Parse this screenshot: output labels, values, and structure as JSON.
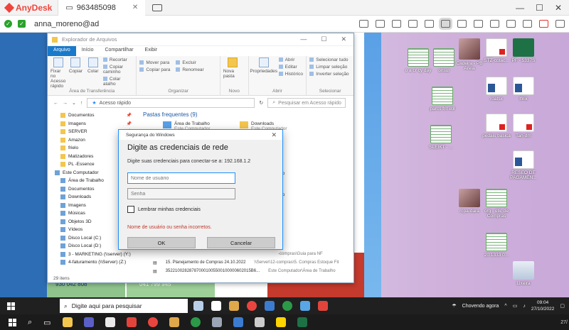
{
  "anydesk": {
    "app_name": "AnyDesk",
    "tab_label": "963485098",
    "address": "anna_moreno@ad"
  },
  "desktop_icons": [
    {
      "label": "o a cr cy day",
      "kind": "sheet"
    },
    {
      "label": "onsul",
      "kind": "sheet"
    },
    {
      "label": "Cadeira - PB Areia",
      "kind": "photo"
    },
    {
      "label": "STZ-cotac...",
      "kind": "pdf"
    },
    {
      "label": "PF - 5337S",
      "kind": "excel"
    },
    {
      "label": "parcs frit etil",
      "kind": "sheet"
    },
    {
      "label": "roatsx",
      "kind": "word"
    },
    {
      "label": "lflrik",
      "kind": "word"
    },
    {
      "label": "SLEIKT - ...",
      "kind": "sheet"
    },
    {
      "label": "pedais basica",
      "kind": "pdf"
    },
    {
      "label": "Tan-dm",
      "kind": "pdf"
    },
    {
      "label": "RESEO DE PAGAMEN...",
      "kind": "word"
    },
    {
      "label": "rcpa-dara",
      "kind": "photo"
    },
    {
      "label": "org - etic de Compras",
      "kind": "sheet"
    },
    {
      "label": "20:1333 0...",
      "kind": "sheet"
    },
    {
      "label": "Lixeira",
      "kind": "recycle"
    }
  ],
  "background": {
    "num1": "930 042 808",
    "num2": "041 799 945"
  },
  "explorer": {
    "title": "Explorador de Arquivos",
    "tabs": [
      "Arquivo",
      "Início",
      "Compartilhar",
      "Exibir"
    ],
    "ribbon": {
      "transfer": {
        "pin": "Fixar no Acesso rápido",
        "copy": "Copiar",
        "paste": "Colar",
        "cut": "Recortar",
        "copy_path": "Copiar caminho",
        "paste_shortcut": "Colar atalho",
        "group": "Área de Transferência"
      },
      "organize": {
        "move": "Mover para",
        "copy_to": "Copiar para",
        "delete": "Excluir",
        "rename": "Renomear",
        "group": "Organizar"
      },
      "new": {
        "new_folder": "Nova pasta",
        "group": "Novo"
      },
      "open": {
        "properties": "Propriedades",
        "open": "Abrir",
        "edit": "Editar",
        "history": "Histórico",
        "group": "Abrir"
      },
      "select": {
        "select_all": "Selecionar tudo",
        "clear": "Limpar seleção",
        "invert": "Inverter seleção",
        "group": "Selecionar"
      }
    },
    "path": "Acesso rápido",
    "search_placeholder": "Pesquisar em Acesso rápido",
    "nav": [
      {
        "label": "Documentos",
        "pin": true
      },
      {
        "label": "Imagens",
        "pin": true
      },
      {
        "label": "SERVER",
        "pin": true
      },
      {
        "label": "Amazon",
        "pin": false
      },
      {
        "label": "frielo",
        "pin": false
      },
      {
        "label": "Matizadores",
        "pin": false
      },
      {
        "label": "PL -Essence",
        "pin": false
      },
      {
        "label": "Este Computador",
        "pin": false,
        "root": true
      },
      {
        "label": "Área de Trabalho",
        "pin": false
      },
      {
        "label": "Documentos",
        "pin": false
      },
      {
        "label": "Downloads",
        "pin": false
      },
      {
        "label": "Imagens",
        "pin": false
      },
      {
        "label": "Músicas",
        "pin": false
      },
      {
        "label": "Objetos 3D",
        "pin": false
      },
      {
        "label": "Vídeos",
        "pin": false
      },
      {
        "label": "Disco Local (C:)",
        "pin": false
      },
      {
        "label": "Disco Local (D:)",
        "pin": false
      },
      {
        "label": "3 - MARKETING (\\\\server) (Y:)",
        "pin": false
      },
      {
        "label": "4-faturamento (\\\\Server) (Z:)",
        "pin": false
      }
    ],
    "status": "29 itens",
    "frequent_title": "Pastas frequentes (9)",
    "tiles": [
      {
        "name": "Área de Trabalho",
        "sub": "Este Computador"
      },
      {
        "name": "Downloads",
        "sub": "Este Computador"
      }
    ],
    "partial_labels": [
      "ador",
      "trabalhando",
      "trabalhando"
    ],
    "recent": [
      {
        "name": "",
        "loc": "-compras\\Guia para NF"
      },
      {
        "name": "15. Planejamento de Compras 24.10.2022",
        "loc": "\\\\Server\\12-compras\\5. Compras Estoque Fit"
      },
      {
        "name": "352210028287870001005500100000602015B6...",
        "loc": "Este Computador\\Área de Trabalho"
      }
    ]
  },
  "dialog": {
    "bar_title": "Segurança do Windows",
    "heading": "Digite as credenciais de rede",
    "description": "Digite suas credenciais para conectar-se a: 192.168.1.2",
    "username_placeholder": "Nome de usuário",
    "password_placeholder": "Senha",
    "remember_label": "Lembrar minhas credenciais",
    "error": "Nome de usuário ou senha incorretos.",
    "ok_label": "OK",
    "cancel_label": "Cancelar"
  },
  "taskbar": {
    "search_placeholder": "Digite aqui para pesquisar",
    "weather": "Chovendo agora",
    "time": "09:04",
    "date": "27/10/2022"
  },
  "host_taskbar": {
    "clock": "27/"
  }
}
